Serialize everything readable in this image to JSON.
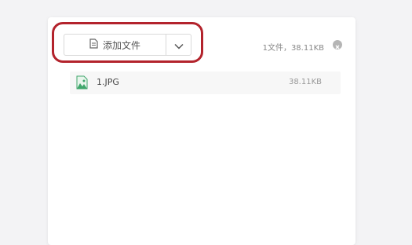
{
  "toolbar": {
    "add_label": "添加文件",
    "add_icon": "document-icon",
    "dropdown_icon": "chevron-down-icon"
  },
  "summary": {
    "text": "1文件，38.11KB",
    "clear_icon": "close-circle-icon"
  },
  "files": [
    {
      "name": "1.JPG",
      "size": "38.11KB",
      "icon": "image-file-icon"
    }
  ],
  "colors": {
    "highlight": "#b3232c",
    "image_icon": "#3fa66b"
  }
}
